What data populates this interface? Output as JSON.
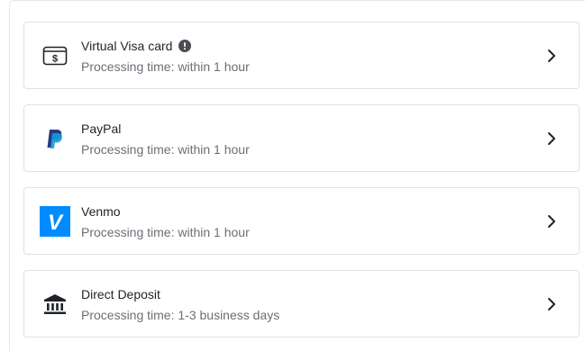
{
  "methods": [
    {
      "title": "Virtual Visa card",
      "subtitle": "Processing time: within 1 hour",
      "icon": "dollar-card-icon",
      "has_info": true
    },
    {
      "title": "PayPal",
      "subtitle": "Processing time: within 1 hour",
      "icon": "paypal-icon",
      "has_info": false
    },
    {
      "title": "Venmo",
      "subtitle": "Processing time: within 1 hour",
      "icon": "venmo-icon",
      "has_info": false
    },
    {
      "title": "Direct Deposit",
      "subtitle": "Processing time: 1-3 business days",
      "icon": "bank-icon",
      "has_info": false
    }
  ],
  "colors": {
    "text_primary": "#1f2328",
    "text_secondary": "#6b6f76",
    "border": "#dfe1e5",
    "paypal_dark": "#253b80",
    "paypal_light": "#179bd7",
    "venmo_blue": "#008cff"
  },
  "icons": {
    "visa_card_glyph": "$",
    "venmo_glyph": "V"
  }
}
